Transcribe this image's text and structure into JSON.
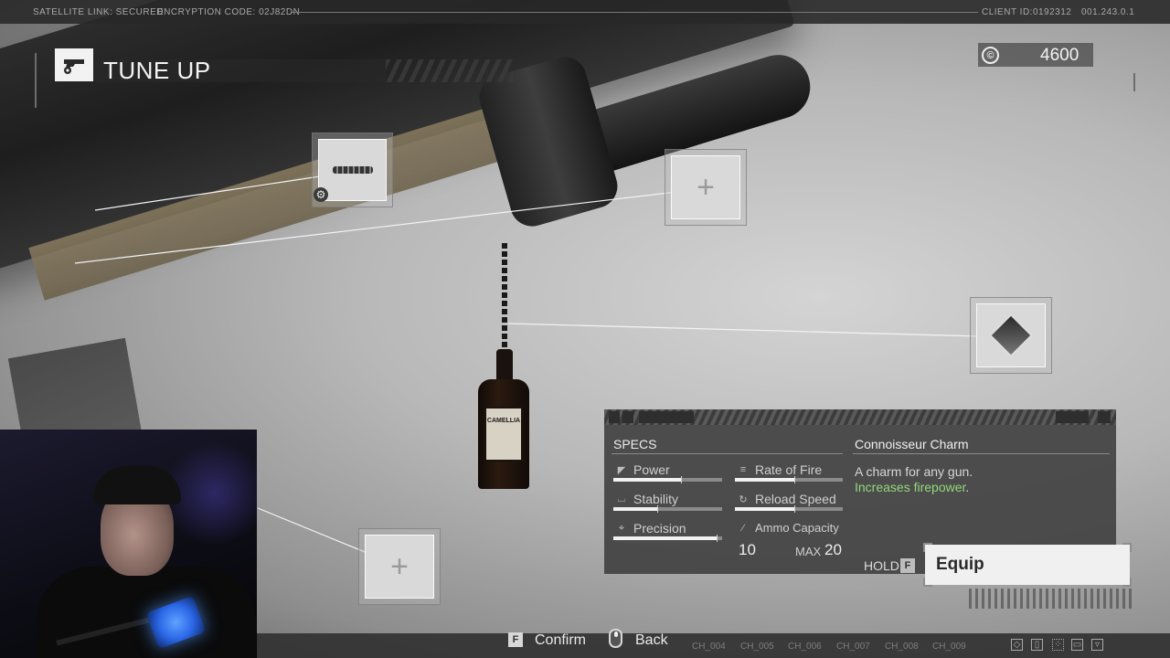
{
  "topbar": {
    "link_status": "SATELLITE LINK: SECURED",
    "encryption": "ENCRYPTION CODE: 02J82DN",
    "client_id": "CLIENT ID:0192312",
    "version": "001.243.0.1"
  },
  "header": {
    "title": "TUNE UP",
    "icon": "pistol-gear-icon"
  },
  "currency": {
    "symbol": "©",
    "amount": "4600"
  },
  "slots": [
    {
      "name": "muzzle-attachment-slot",
      "state": "equipped",
      "icon": "suppressor-icon"
    },
    {
      "name": "top-rail-slot",
      "state": "empty",
      "icon": "plus-icon"
    },
    {
      "name": "charm-slot",
      "state": "equipped",
      "icon": "charm-icon"
    },
    {
      "name": "underbarrel-slot",
      "state": "empty",
      "icon": "plus-icon"
    }
  ],
  "bottle_label": "CAMELLIA",
  "specs": {
    "heading": "SPECS",
    "stats": [
      {
        "label": "Power",
        "icon": "pistol-icon",
        "value": 0.62
      },
      {
        "label": "Rate of Fire",
        "icon": "bullets-icon",
        "value": 0.55
      },
      {
        "label": "Stability",
        "icon": "stability-icon",
        "value": 0.4
      },
      {
        "label": "Reload Speed",
        "icon": "reload-icon",
        "value": 0.55
      },
      {
        "label": "Precision",
        "icon": "crosshair-icon",
        "value": 0.95
      },
      {
        "label": "Ammo Capacity",
        "icon": "magazine-icon"
      }
    ],
    "ammo_current": "10",
    "ammo_max_label": "MAX",
    "ammo_max": "20"
  },
  "item": {
    "name": "Connoisseur Charm",
    "description": "A charm for any gun.",
    "bonus": "Increases firepower",
    "bonus_suffix": "."
  },
  "equip": {
    "hold_label": "HOLD",
    "key": "F",
    "label": "Equip"
  },
  "prompts": {
    "confirm_key": "F",
    "confirm_label": "Confirm",
    "back_label": "Back"
  },
  "channels": [
    "CH_004",
    "CH_005",
    "CH_006",
    "CH_007",
    "CH_008",
    "CH_009"
  ],
  "colors": {
    "accent_green": "#93d77a",
    "panel_bg": "#424242",
    "equip_bg": "#f0f0f0"
  }
}
